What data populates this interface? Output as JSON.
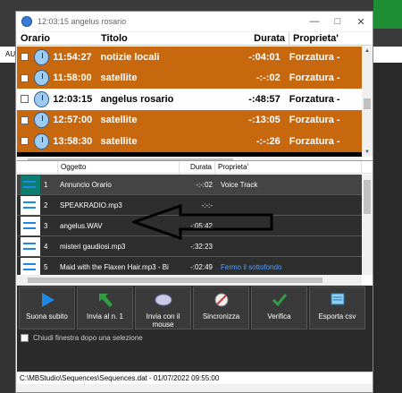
{
  "window": {
    "title": "12:03:15 angelus rosario"
  },
  "background": {
    "left_label": "AU"
  },
  "schedule": {
    "columns": [
      "Orario",
      "Titolo",
      "Durata",
      "Proprieta'"
    ],
    "rows": [
      {
        "time": "11:54:27",
        "title": "notizie locali",
        "duration": "-:04:01",
        "property": "Forzatura -",
        "selected": false
      },
      {
        "time": "11:58:00",
        "title": "satellite",
        "duration": "-:-:02",
        "property": "Forzatura -",
        "selected": false
      },
      {
        "time": "12:03:15",
        "title": "angelus rosario",
        "duration": "-:48:57",
        "property": "Forzatura -",
        "selected": true
      },
      {
        "time": "12:57:00",
        "title": "satellite",
        "duration": "-:13:05",
        "property": "Forzatura -",
        "selected": false
      },
      {
        "time": "13:58:30",
        "title": "satellite",
        "duration": "-:-:26",
        "property": "Forzatura -",
        "selected": false
      }
    ]
  },
  "list": {
    "columns": [
      "Oggetto",
      "Durata",
      "Proprieta'"
    ],
    "rows": [
      {
        "num": "1",
        "object": "Annuncio Orario",
        "duration": "-:-:02",
        "property": "Voice Track",
        "icon": "green-wave-icon"
      },
      {
        "num": "2",
        "object": "SPEAKRADIO.mp3",
        "duration": "-:-:-",
        "property": "",
        "icon": "audio-file-icon"
      },
      {
        "num": "3",
        "object": "angelus.WAV",
        "duration": "-:05:42",
        "property": "",
        "icon": "audio-file-icon"
      },
      {
        "num": "4",
        "object": "misteri gaudiosi.mp3",
        "duration": "-:32:23",
        "property": "",
        "icon": "audio-file-icon"
      },
      {
        "num": "5",
        "object": "Maid with the Flaxen Hair.mp3 - Bi",
        "duration": "-:02:49",
        "property": "Fermo il sottofondo",
        "icon": "audio-file-error-icon"
      }
    ]
  },
  "actions": [
    {
      "label": "Suona subito",
      "icon": "play-icon"
    },
    {
      "label": "Invia al n. 1",
      "icon": "send-up-icon"
    },
    {
      "label": "Invia con il mouse",
      "icon": "mouse-icon"
    },
    {
      "label": "Sincronizza",
      "icon": "sync-icon"
    },
    {
      "label": "Verifica",
      "icon": "check-icon"
    },
    {
      "label": "Esporta csv",
      "icon": "export-icon"
    }
  ],
  "options": {
    "close_after_label": "Chiudi finestra dopo una selezione"
  },
  "status": {
    "path": "C:\\MBStudio\\Sequences\\Sequences.dat - 01/07/2022 09:55:00"
  },
  "colors": {
    "row_orange": "#c8680e",
    "accent_blue": "#1e88e5",
    "check_green": "#2ea043"
  }
}
